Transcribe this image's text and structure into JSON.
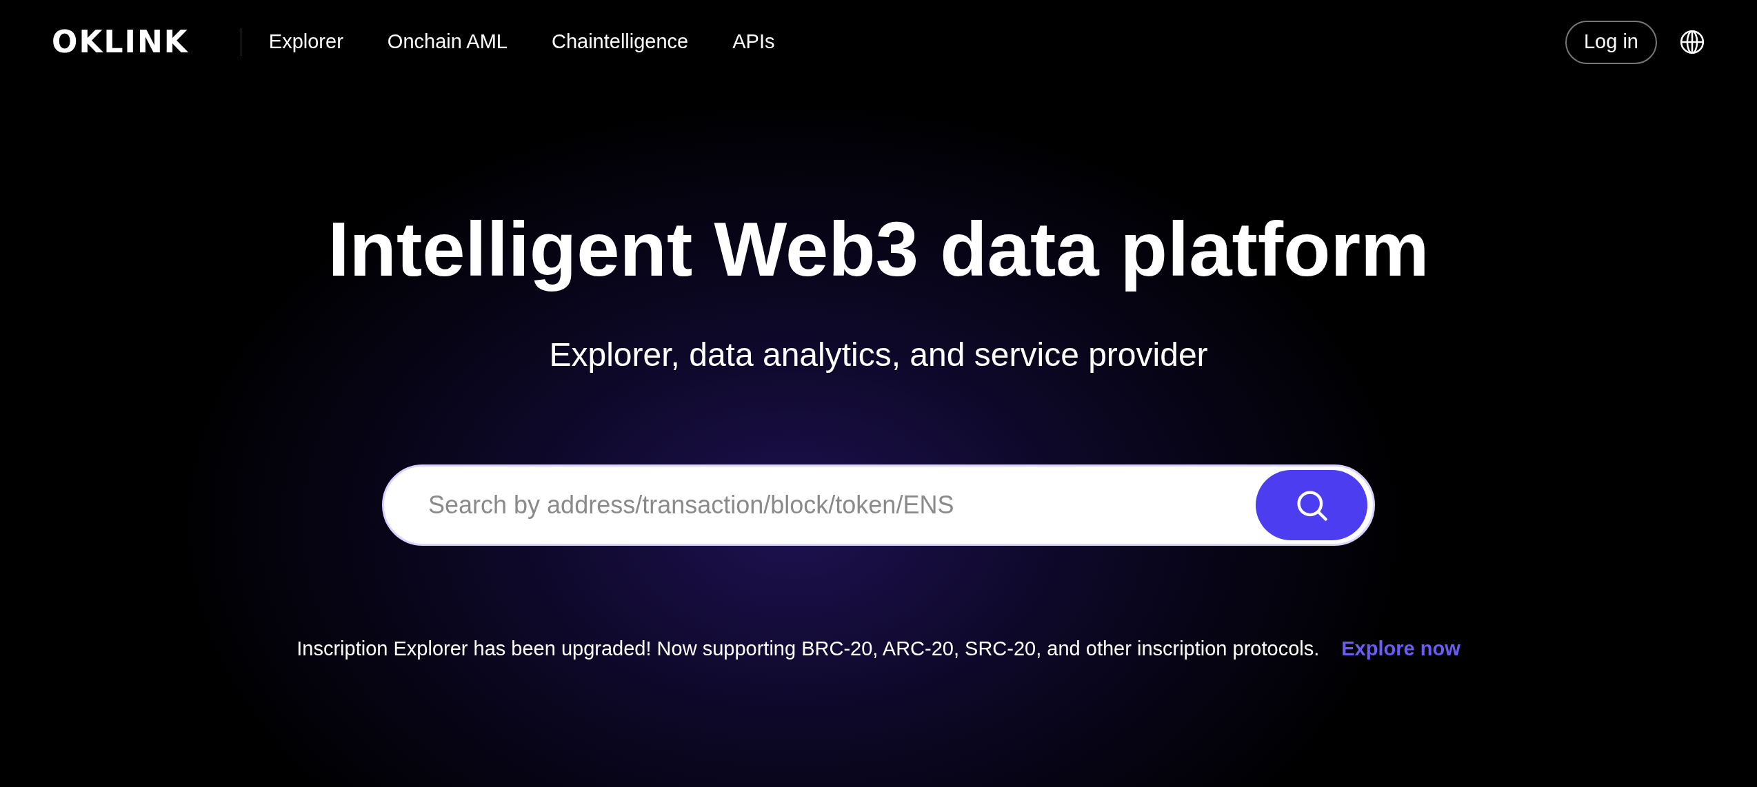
{
  "header": {
    "logo": "OKLINK",
    "nav": [
      {
        "label": "Explorer"
      },
      {
        "label": "Onchain AML"
      },
      {
        "label": "Chaintelligence"
      },
      {
        "label": "APIs"
      }
    ],
    "login": "Log in"
  },
  "hero": {
    "title": "Intelligent Web3 data platform",
    "subtitle": "Explorer, data analytics, and service provider",
    "search": {
      "placeholder": "Search by address/transaction/block/token/ENS"
    },
    "notice": "Inscription Explorer has been upgraded! Now supporting BRC-20, ARC-20, SRC-20, and other inscription protocols.",
    "notice_link": "Explore now"
  }
}
